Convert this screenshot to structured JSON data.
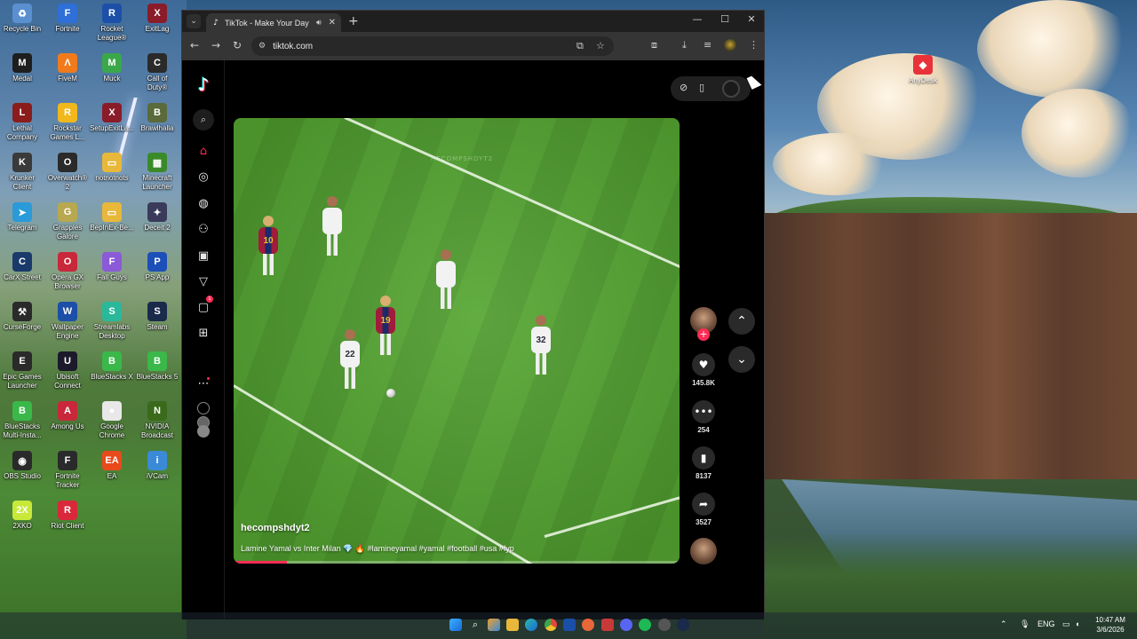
{
  "desktop": {
    "icons": [
      {
        "label": "Recycle Bin",
        "glyph": "♻",
        "color": "#5a8fd0"
      },
      {
        "label": "Fortnite",
        "glyph": "F",
        "color": "#2f6fd8"
      },
      {
        "label": "Rocket\nLeague®",
        "glyph": "R",
        "color": "#1c4fa8"
      },
      {
        "label": "ExitLag",
        "glyph": "X",
        "color": "#8a1c2a"
      },
      {
        "label": "Medal",
        "glyph": "M",
        "color": "#1e1e1e"
      },
      {
        "label": "FiveM",
        "glyph": "Λ",
        "color": "#f07a1c"
      },
      {
        "label": "Muck",
        "glyph": "M",
        "color": "#3aa84a"
      },
      {
        "label": "Call of\nDuty®",
        "glyph": "C",
        "color": "#2a2a2a"
      },
      {
        "label": "Lethal\nCompany",
        "glyph": "L",
        "color": "#8a1c1c"
      },
      {
        "label": "Rockstar\nGames L...",
        "glyph": "R",
        "color": "#f0b81c"
      },
      {
        "label": "SetupExitLa...",
        "glyph": "X",
        "color": "#8a1c2a"
      },
      {
        "label": "Brawlhalla",
        "glyph": "B",
        "color": "#5a6a3a"
      },
      {
        "label": "Krunker\nClient",
        "glyph": "K",
        "color": "#3a3a3a"
      },
      {
        "label": "Overwatch®\n2",
        "glyph": "O",
        "color": "#2a2a2a"
      },
      {
        "label": "notnotnots",
        "glyph": "▭",
        "color": "#e8b83a"
      },
      {
        "label": "Minecraft\nLauncher",
        "glyph": "▦",
        "color": "#3a8a2a"
      },
      {
        "label": "Telegram",
        "glyph": "➤",
        "color": "#2a9ad8"
      },
      {
        "label": "Grapples\nGalore",
        "glyph": "G",
        "color": "#b8a850"
      },
      {
        "label": "BepInEx-Be...",
        "glyph": "▭",
        "color": "#e8b83a"
      },
      {
        "label": "Deceit 2",
        "glyph": "✦",
        "color": "#3a3a5a"
      },
      {
        "label": "CarX Street",
        "glyph": "C",
        "color": "#1a3a6a"
      },
      {
        "label": "Opera GX\nBrowser",
        "glyph": "O",
        "color": "#c8283a"
      },
      {
        "label": "Fall Guys",
        "glyph": "F",
        "color": "#8a5ad8"
      },
      {
        "label": "PS App",
        "glyph": "P",
        "color": "#1c4fb8"
      },
      {
        "label": "CurseForge",
        "glyph": "⚒",
        "color": "#2a2a2a"
      },
      {
        "label": "Wallpaper\nEngine",
        "glyph": "W",
        "color": "#1c4fa8"
      },
      {
        "label": "Streamlabs\nDesktop",
        "glyph": "S",
        "color": "#2ab89a"
      },
      {
        "label": "Steam",
        "glyph": "S",
        "color": "#1a2a4a"
      },
      {
        "label": "Epic Games\nLauncher",
        "glyph": "E",
        "color": "#2a2a2a"
      },
      {
        "label": "Ubisoft\nConnect",
        "glyph": "U",
        "color": "#1a1a2a"
      },
      {
        "label": "BlueStacks X",
        "glyph": "B",
        "color": "#3ab84a"
      },
      {
        "label": "BlueStacks 5",
        "glyph": "B",
        "color": "#3ab84a"
      },
      {
        "label": "BlueStacks\nMulti-Insta...",
        "glyph": "B",
        "color": "#3ab84a"
      },
      {
        "label": "Among Us",
        "glyph": "A",
        "color": "#c8283a"
      },
      {
        "label": "Google\nChrome",
        "glyph": "●",
        "color": "#e8e8e8"
      },
      {
        "label": "NVIDIA\nBroadcast",
        "glyph": "N",
        "color": "#3a6a1a"
      },
      {
        "label": "OBS Studio",
        "glyph": "◉",
        "color": "#2a2a2a"
      },
      {
        "label": "Fortnite\nTracker",
        "glyph": "F",
        "color": "#2a2a2a"
      },
      {
        "label": "EA",
        "glyph": "EA",
        "color": "#e84a1c"
      },
      {
        "label": "iVCam",
        "glyph": "i",
        "color": "#3a8ad8"
      },
      {
        "label": "2XKO",
        "glyph": "2X",
        "color": "#c8e83a"
      },
      {
        "label": "Riot Client",
        "glyph": "R",
        "color": "#d8283a"
      }
    ],
    "anydesk": {
      "label": "AnyDesk",
      "glyph": "◆"
    }
  },
  "browser": {
    "tab_title": "TikTok - Make Your Day",
    "url": "tiktok.com"
  },
  "video": {
    "watermark": "HECOMPSHDYT2",
    "author": "hecompshdyt2",
    "caption": "Lamine Yamal vs Inter Milan 💎 🔥 #lamineyamal #yamal #football #usa #fyp",
    "progress_fraction": 0.12,
    "players": [
      {
        "num": "10",
        "team": "barca"
      },
      {
        "num": "",
        "team": "inter"
      },
      {
        "num": "",
        "team": "inter"
      },
      {
        "num": "19",
        "team": "barca"
      },
      {
        "num": "32",
        "team": "inter"
      },
      {
        "num": "22",
        "team": "inter"
      }
    ]
  },
  "actions": {
    "likes": "145.8K",
    "comments": "254",
    "saves": "8137",
    "shares": "3527"
  },
  "taskbar": {
    "lang": "ENG",
    "time": "10:47 AM",
    "date": "3/6/2026"
  },
  "colors": {
    "accent": "#fe2c55",
    "tiktok_cyan": "#25f4ee"
  }
}
